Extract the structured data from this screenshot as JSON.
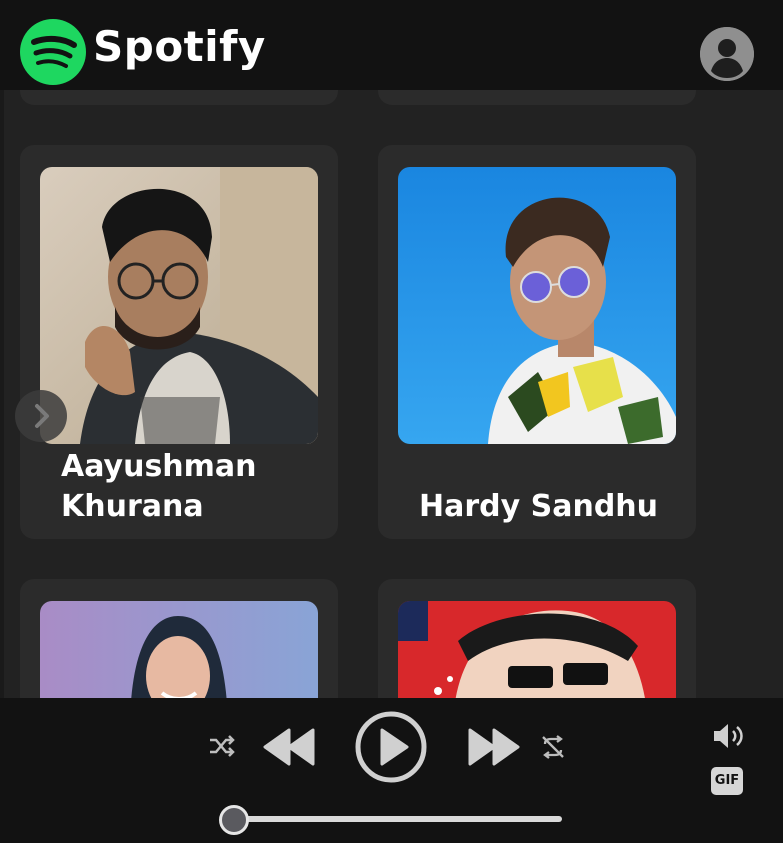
{
  "app": {
    "brand": "Spotify",
    "accent": "#1ED760"
  },
  "navbar": {
    "logo_icon": "spotify-logo-icon",
    "profile_icon": "user-circle-icon"
  },
  "artists": [
    {
      "name": "Aayushman Khurana",
      "name_lines": [
        "Aayushman",
        "Khurana"
      ]
    },
    {
      "name": "Hardy Sandhu"
    },
    {
      "name": ""
    },
    {
      "name": ""
    }
  ],
  "player": {
    "controls": [
      "shuffle-icon",
      "previous-icon",
      "play-icon",
      "next-icon",
      "repeat-off-icon",
      "volume-icon"
    ],
    "gif_label": "GIF",
    "progress": 0.0
  }
}
